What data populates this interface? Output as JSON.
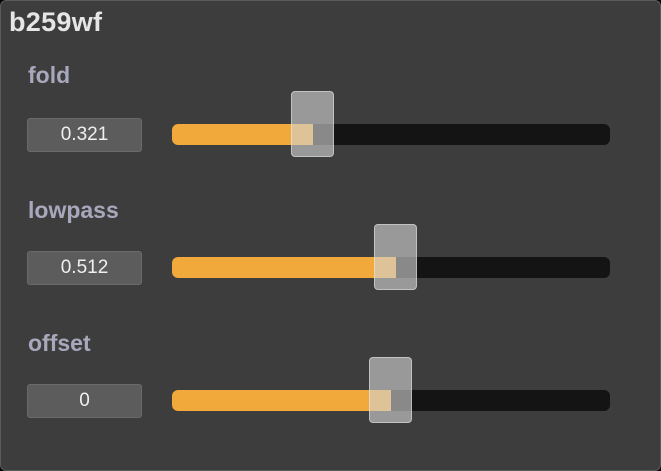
{
  "title": "b259wf",
  "params": [
    {
      "label": "fold",
      "display": "0.321",
      "fraction": 0.321
    },
    {
      "label": "lowpass",
      "display": "0.512",
      "fraction": 0.512
    },
    {
      "label": "offset",
      "display": "0",
      "fraction": 0.5
    }
  ],
  "colors": {
    "panel": "#3d3d3d",
    "fill": "#f2a93b",
    "track": "#141414",
    "label": "#a8a8bd"
  }
}
